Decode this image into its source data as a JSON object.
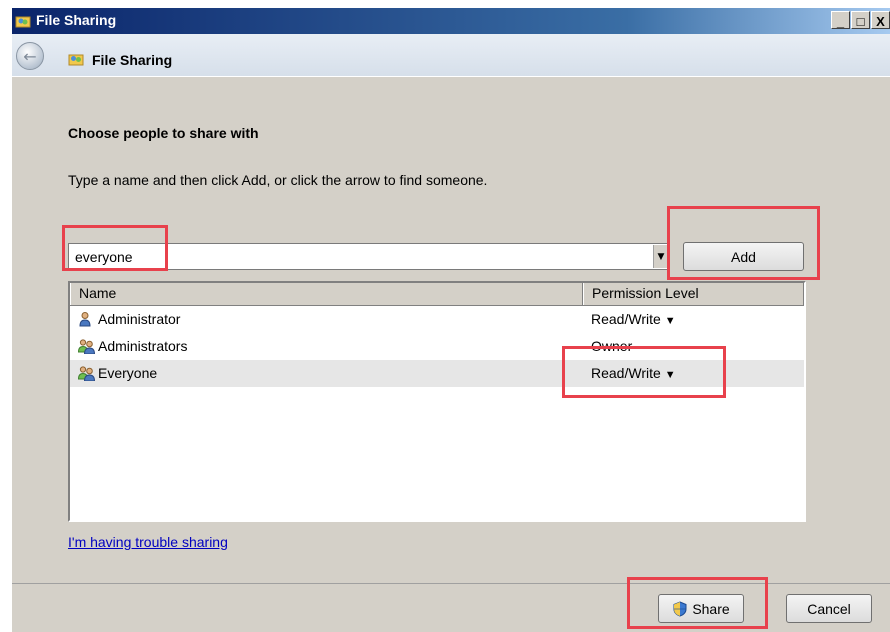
{
  "window": {
    "title": "File Sharing",
    "minimize_label": "_",
    "maximize_label": "□",
    "close_label": "X"
  },
  "nav": {
    "back_label": "←",
    "title": "File Sharing"
  },
  "content": {
    "heading": "Choose people to share with",
    "instruction": "Type a name and then click Add, or click the arrow to find someone.",
    "input_value": "everyone",
    "add_label": "Add",
    "dropdown_arrow": "▼",
    "columns": [
      "Name",
      "Permission Level"
    ],
    "rows": [
      {
        "name": "Administrator",
        "permission": "Read/Write",
        "has_arrow": true,
        "icon": "user-icon"
      },
      {
        "name": "Administrators",
        "permission": "Owner",
        "has_arrow": false,
        "icon": "group-icon"
      },
      {
        "name": "Everyone",
        "permission": "Read/Write",
        "has_arrow": true,
        "icon": "group-icon",
        "selected": true
      }
    ],
    "trouble_link": "I'm having trouble sharing"
  },
  "footer": {
    "share_label": "Share",
    "cancel_label": "Cancel"
  },
  "colors": {
    "highlight": "#e8414c",
    "link": "#0000c0",
    "titlebar": "#0a246a"
  }
}
